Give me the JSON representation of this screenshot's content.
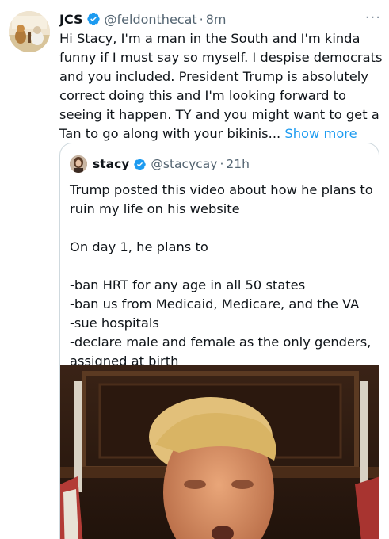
{
  "tweet": {
    "author_name": "JCS",
    "handle": "@feldonthecat",
    "separator": "·",
    "time": "8m",
    "more_icon": "more-horizontal-icon",
    "text": "Hi Stacy, I'm a man in the South and I'm kinda funny if I must say so myself. I despise democrats and you included. President Trump is absolutely correct doing this and I'm looking forward to seeing it happen. TY and you might want to get a Tan to go along with your bikinis...",
    "show_more": "Show more"
  },
  "quote": {
    "author_name": "stacy",
    "handle": "@stacycay",
    "separator": "·",
    "time": "21h",
    "text": "Trump posted this video about how he plans to ruin my life on his website\n\nOn day 1, he plans to\n\n-ban HRT for any age in all 50 states\n-ban us from Medicaid, Medicare, and the VA\n-sue hospitals\n-declare male and female as the only genders, assigned at birth"
  },
  "colors": {
    "verified": "#1d9bf0",
    "link": "#1d9bf0",
    "muted": "#536471",
    "border": "#cfd9de"
  }
}
